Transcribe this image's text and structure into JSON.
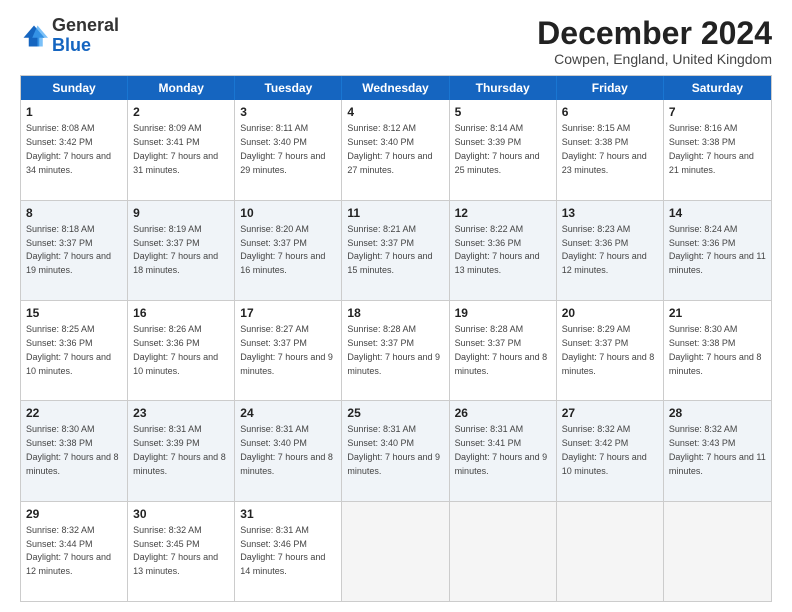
{
  "logo": {
    "general": "General",
    "blue": "Blue"
  },
  "title": "December 2024",
  "location": "Cowpen, England, United Kingdom",
  "header_days": [
    "Sunday",
    "Monday",
    "Tuesday",
    "Wednesday",
    "Thursday",
    "Friday",
    "Saturday"
  ],
  "rows": [
    [
      {
        "day": "1",
        "sunrise": "8:08 AM",
        "sunset": "3:42 PM",
        "daylight": "7 hours and 34 minutes."
      },
      {
        "day": "2",
        "sunrise": "8:09 AM",
        "sunset": "3:41 PM",
        "daylight": "7 hours and 31 minutes."
      },
      {
        "day": "3",
        "sunrise": "8:11 AM",
        "sunset": "3:40 PM",
        "daylight": "7 hours and 29 minutes."
      },
      {
        "day": "4",
        "sunrise": "8:12 AM",
        "sunset": "3:40 PM",
        "daylight": "7 hours and 27 minutes."
      },
      {
        "day": "5",
        "sunrise": "8:14 AM",
        "sunset": "3:39 PM",
        "daylight": "7 hours and 25 minutes."
      },
      {
        "day": "6",
        "sunrise": "8:15 AM",
        "sunset": "3:38 PM",
        "daylight": "7 hours and 23 minutes."
      },
      {
        "day": "7",
        "sunrise": "8:16 AM",
        "sunset": "3:38 PM",
        "daylight": "7 hours and 21 minutes."
      }
    ],
    [
      {
        "day": "8",
        "sunrise": "8:18 AM",
        "sunset": "3:37 PM",
        "daylight": "7 hours and 19 minutes."
      },
      {
        "day": "9",
        "sunrise": "8:19 AM",
        "sunset": "3:37 PM",
        "daylight": "7 hours and 18 minutes."
      },
      {
        "day": "10",
        "sunrise": "8:20 AM",
        "sunset": "3:37 PM",
        "daylight": "7 hours and 16 minutes."
      },
      {
        "day": "11",
        "sunrise": "8:21 AM",
        "sunset": "3:37 PM",
        "daylight": "7 hours and 15 minutes."
      },
      {
        "day": "12",
        "sunrise": "8:22 AM",
        "sunset": "3:36 PM",
        "daylight": "7 hours and 13 minutes."
      },
      {
        "day": "13",
        "sunrise": "8:23 AM",
        "sunset": "3:36 PM",
        "daylight": "7 hours and 12 minutes."
      },
      {
        "day": "14",
        "sunrise": "8:24 AM",
        "sunset": "3:36 PM",
        "daylight": "7 hours and 11 minutes."
      }
    ],
    [
      {
        "day": "15",
        "sunrise": "8:25 AM",
        "sunset": "3:36 PM",
        "daylight": "7 hours and 10 minutes."
      },
      {
        "day": "16",
        "sunrise": "8:26 AM",
        "sunset": "3:36 PM",
        "daylight": "7 hours and 10 minutes."
      },
      {
        "day": "17",
        "sunrise": "8:27 AM",
        "sunset": "3:37 PM",
        "daylight": "7 hours and 9 minutes."
      },
      {
        "day": "18",
        "sunrise": "8:28 AM",
        "sunset": "3:37 PM",
        "daylight": "7 hours and 9 minutes."
      },
      {
        "day": "19",
        "sunrise": "8:28 AM",
        "sunset": "3:37 PM",
        "daylight": "7 hours and 8 minutes."
      },
      {
        "day": "20",
        "sunrise": "8:29 AM",
        "sunset": "3:37 PM",
        "daylight": "7 hours and 8 minutes."
      },
      {
        "day": "21",
        "sunrise": "8:30 AM",
        "sunset": "3:38 PM",
        "daylight": "7 hours and 8 minutes."
      }
    ],
    [
      {
        "day": "22",
        "sunrise": "8:30 AM",
        "sunset": "3:38 PM",
        "daylight": "7 hours and 8 minutes."
      },
      {
        "day": "23",
        "sunrise": "8:31 AM",
        "sunset": "3:39 PM",
        "daylight": "7 hours and 8 minutes."
      },
      {
        "day": "24",
        "sunrise": "8:31 AM",
        "sunset": "3:40 PM",
        "daylight": "7 hours and 8 minutes."
      },
      {
        "day": "25",
        "sunrise": "8:31 AM",
        "sunset": "3:40 PM",
        "daylight": "7 hours and 9 minutes."
      },
      {
        "day": "26",
        "sunrise": "8:31 AM",
        "sunset": "3:41 PM",
        "daylight": "7 hours and 9 minutes."
      },
      {
        "day": "27",
        "sunrise": "8:32 AM",
        "sunset": "3:42 PM",
        "daylight": "7 hours and 10 minutes."
      },
      {
        "day": "28",
        "sunrise": "8:32 AM",
        "sunset": "3:43 PM",
        "daylight": "7 hours and 11 minutes."
      }
    ],
    [
      {
        "day": "29",
        "sunrise": "8:32 AM",
        "sunset": "3:44 PM",
        "daylight": "7 hours and 12 minutes."
      },
      {
        "day": "30",
        "sunrise": "8:32 AM",
        "sunset": "3:45 PM",
        "daylight": "7 hours and 13 minutes."
      },
      {
        "day": "31",
        "sunrise": "8:31 AM",
        "sunset": "3:46 PM",
        "daylight": "7 hours and 14 minutes."
      },
      null,
      null,
      null,
      null
    ]
  ],
  "row_alts": [
    false,
    true,
    false,
    true,
    false
  ]
}
